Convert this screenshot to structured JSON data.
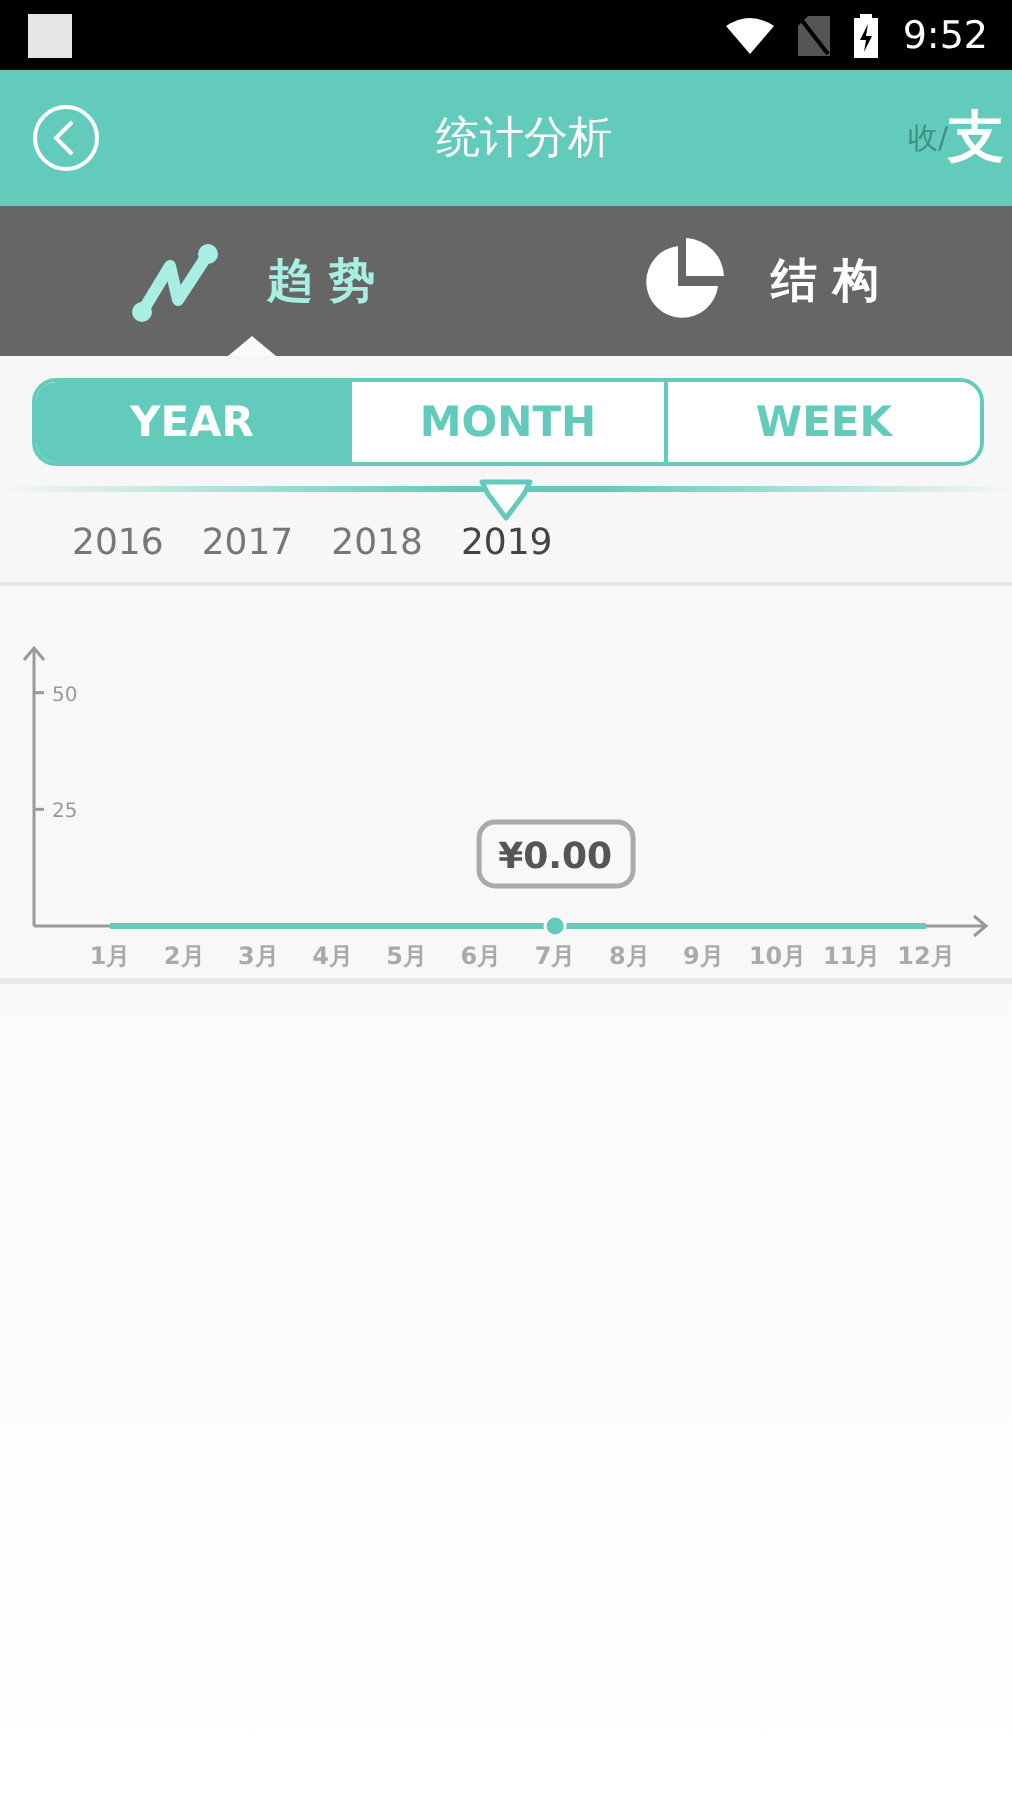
{
  "status_bar": {
    "time": "9:52"
  },
  "header": {
    "title": "统计分析",
    "type_toggle": [
      {
        "label": "收",
        "selected": false
      },
      {
        "label": "支",
        "selected": true
      }
    ],
    "separator": "/"
  },
  "tabs": [
    {
      "label": "趋 势",
      "kind": "trend",
      "selected": true
    },
    {
      "label": "结 构",
      "kind": "structure",
      "selected": false
    }
  ],
  "periods": [
    {
      "label": "YEAR",
      "selected": true
    },
    {
      "label": "MONTH",
      "selected": false
    },
    {
      "label": "WEEK",
      "selected": false
    }
  ],
  "years": [
    {
      "label": "2016",
      "selected": false
    },
    {
      "label": "2017",
      "selected": false
    },
    {
      "label": "2018",
      "selected": false
    },
    {
      "label": "2019",
      "selected": true
    }
  ],
  "chart": {
    "tooltip": "¥0.00",
    "chart_data": {
      "type": "line",
      "categories": [
        "1月",
        "2月",
        "3月",
        "4月",
        "5月",
        "6月",
        "7月",
        "8月",
        "9月",
        "10月",
        "11月",
        "12月"
      ],
      "series": [
        {
          "color": "#63cbbb",
          "values": [
            0,
            0,
            0,
            0,
            0,
            0,
            0,
            0,
            0,
            0,
            0,
            0
          ]
        }
      ],
      "ylim": [
        0,
        60
      ],
      "yticks": [
        25,
        50
      ]
    }
  }
}
